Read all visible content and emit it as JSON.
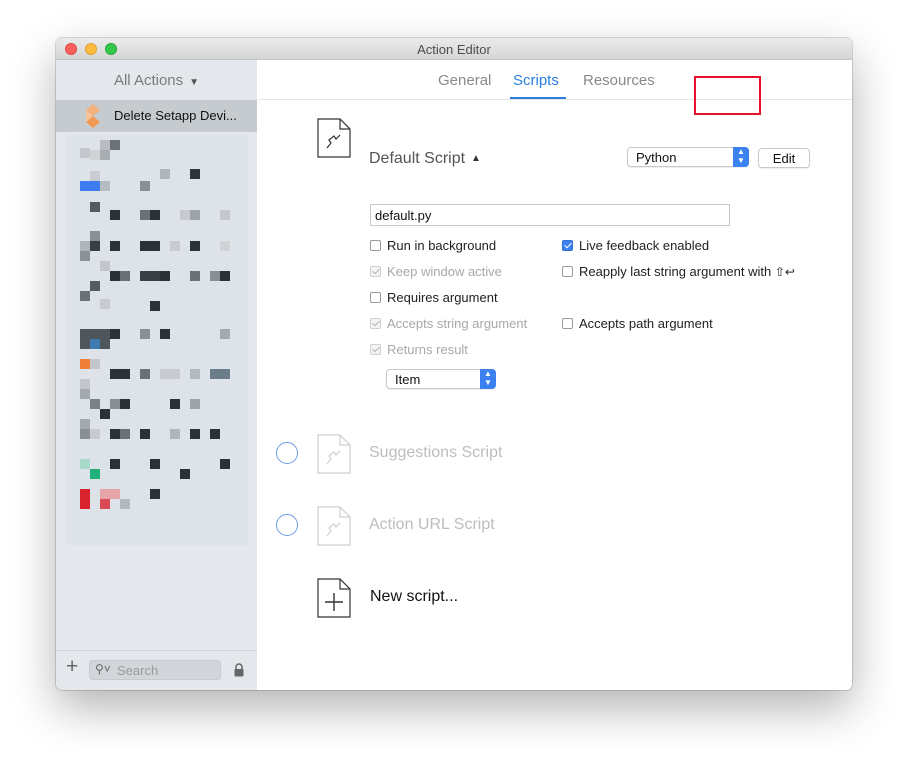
{
  "window": {
    "title": "Action Editor"
  },
  "sidebar": {
    "filter_label": "All Actions",
    "selected_item": "Delete Setapp Devi...",
    "search_placeholder": "Search"
  },
  "tabs": [
    {
      "label": "General",
      "active": false
    },
    {
      "label": "Scripts",
      "active": true
    },
    {
      "label": "Resources",
      "active": false
    }
  ],
  "default_script": {
    "title": "Default Script",
    "language": "Python",
    "edit_label": "Edit",
    "filename": "default.py",
    "options_left": [
      {
        "label": "Run in background",
        "checked": false,
        "enabled": true
      },
      {
        "label": "Keep window active",
        "checked": true,
        "enabled": false
      },
      {
        "label": "Requires argument",
        "checked": false,
        "enabled": true
      },
      {
        "label": "Accepts string argument",
        "checked": true,
        "enabled": false
      },
      {
        "label": "Returns result",
        "checked": true,
        "enabled": false
      }
    ],
    "options_right": [
      {
        "label": "Live feedback enabled",
        "checked": true,
        "enabled": true
      },
      {
        "label": "Reapply last string argument with",
        "shortcut": "⇧↩",
        "checked": false,
        "enabled": true
      },
      {
        "label": "Accepts path argument",
        "checked": false,
        "enabled": true
      }
    ],
    "result_type": "Item"
  },
  "other_scripts": [
    {
      "title": "Suggestions Script"
    },
    {
      "title": "Action URL Script"
    }
  ],
  "new_script_label": "New script...",
  "colors": {
    "accent": "#2d7fdc",
    "highlight": "#e8112d",
    "sidebar_bg": "#e4e8ec"
  },
  "icons": [
    "plus-icon",
    "search-icon",
    "lock-icon",
    "script-document-icon",
    "chevron-down-icon"
  ]
}
